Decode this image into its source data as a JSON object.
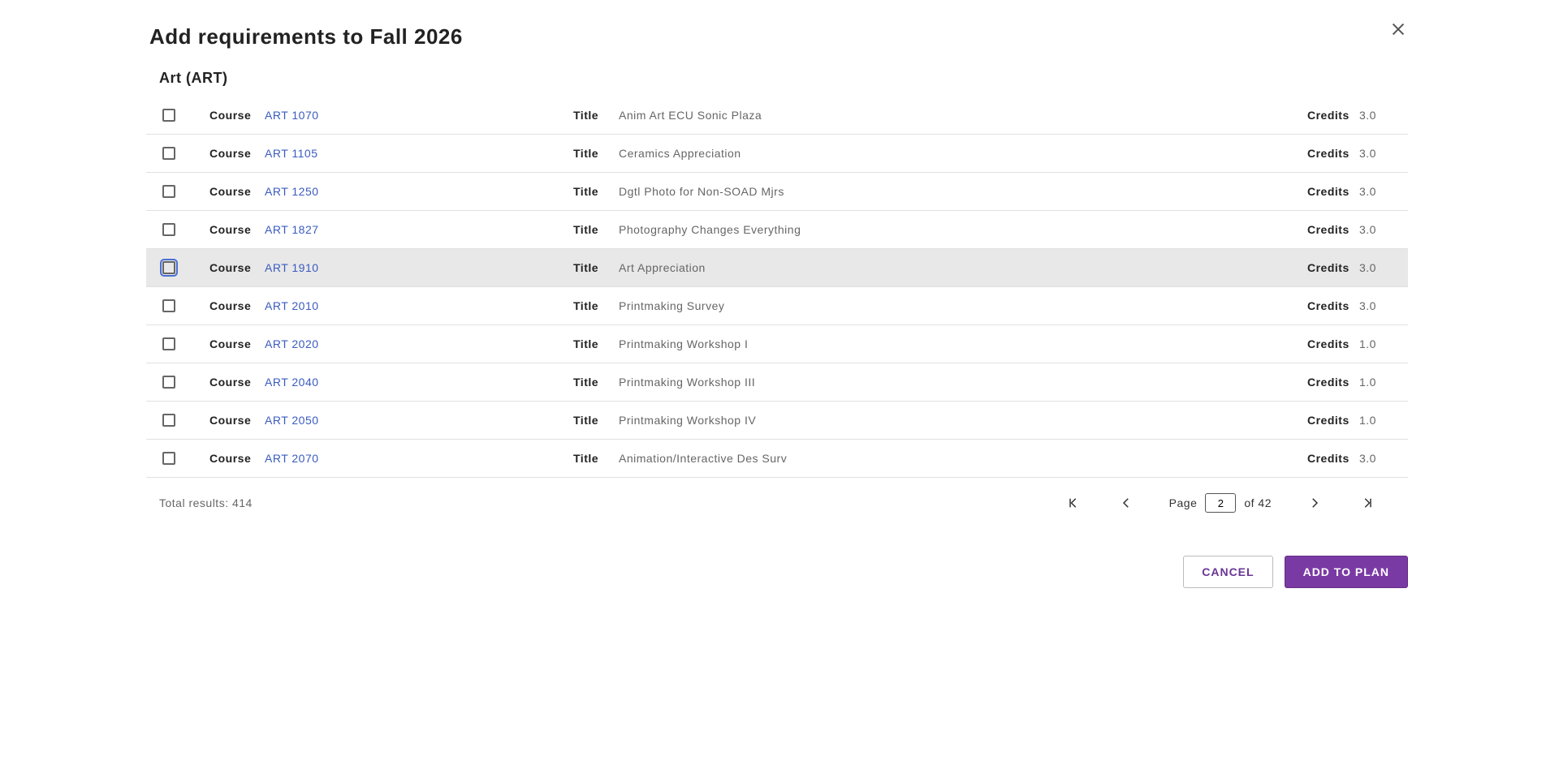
{
  "dialog": {
    "title": "Add requirements to Fall 2026"
  },
  "section": {
    "header": "Art (ART)"
  },
  "labels": {
    "course": "Course",
    "title": "Title",
    "credits": "Credits"
  },
  "rows": [
    {
      "code": "ART 1070",
      "title": "Anim Art ECU Sonic Plaza",
      "credits": "3.0",
      "highlight": false
    },
    {
      "code": "ART 1105",
      "title": "Ceramics Appreciation",
      "credits": "3.0",
      "highlight": false
    },
    {
      "code": "ART 1250",
      "title": "Dgtl Photo for Non-SOAD Mjrs",
      "credits": "3.0",
      "highlight": false
    },
    {
      "code": "ART 1827",
      "title": "Photography Changes Everything",
      "credits": "3.0",
      "highlight": false
    },
    {
      "code": "ART 1910",
      "title": "Art Appreciation",
      "credits": "3.0",
      "highlight": true
    },
    {
      "code": "ART 2010",
      "title": "Printmaking Survey",
      "credits": "3.0",
      "highlight": false
    },
    {
      "code": "ART 2020",
      "title": "Printmaking Workshop I",
      "credits": "1.0",
      "highlight": false
    },
    {
      "code": "ART 2040",
      "title": "Printmaking Workshop III",
      "credits": "1.0",
      "highlight": false
    },
    {
      "code": "ART 2050",
      "title": "Printmaking Workshop IV",
      "credits": "1.0",
      "highlight": false
    },
    {
      "code": "ART 2070",
      "title": "Animation/Interactive Des Surv",
      "credits": "3.0",
      "highlight": false
    }
  ],
  "pager": {
    "total_label": "Total results: 414",
    "page_label": "Page",
    "current": "2",
    "of_label": "of 42"
  },
  "footer": {
    "cancel": "CANCEL",
    "add": "ADD TO PLAN"
  }
}
